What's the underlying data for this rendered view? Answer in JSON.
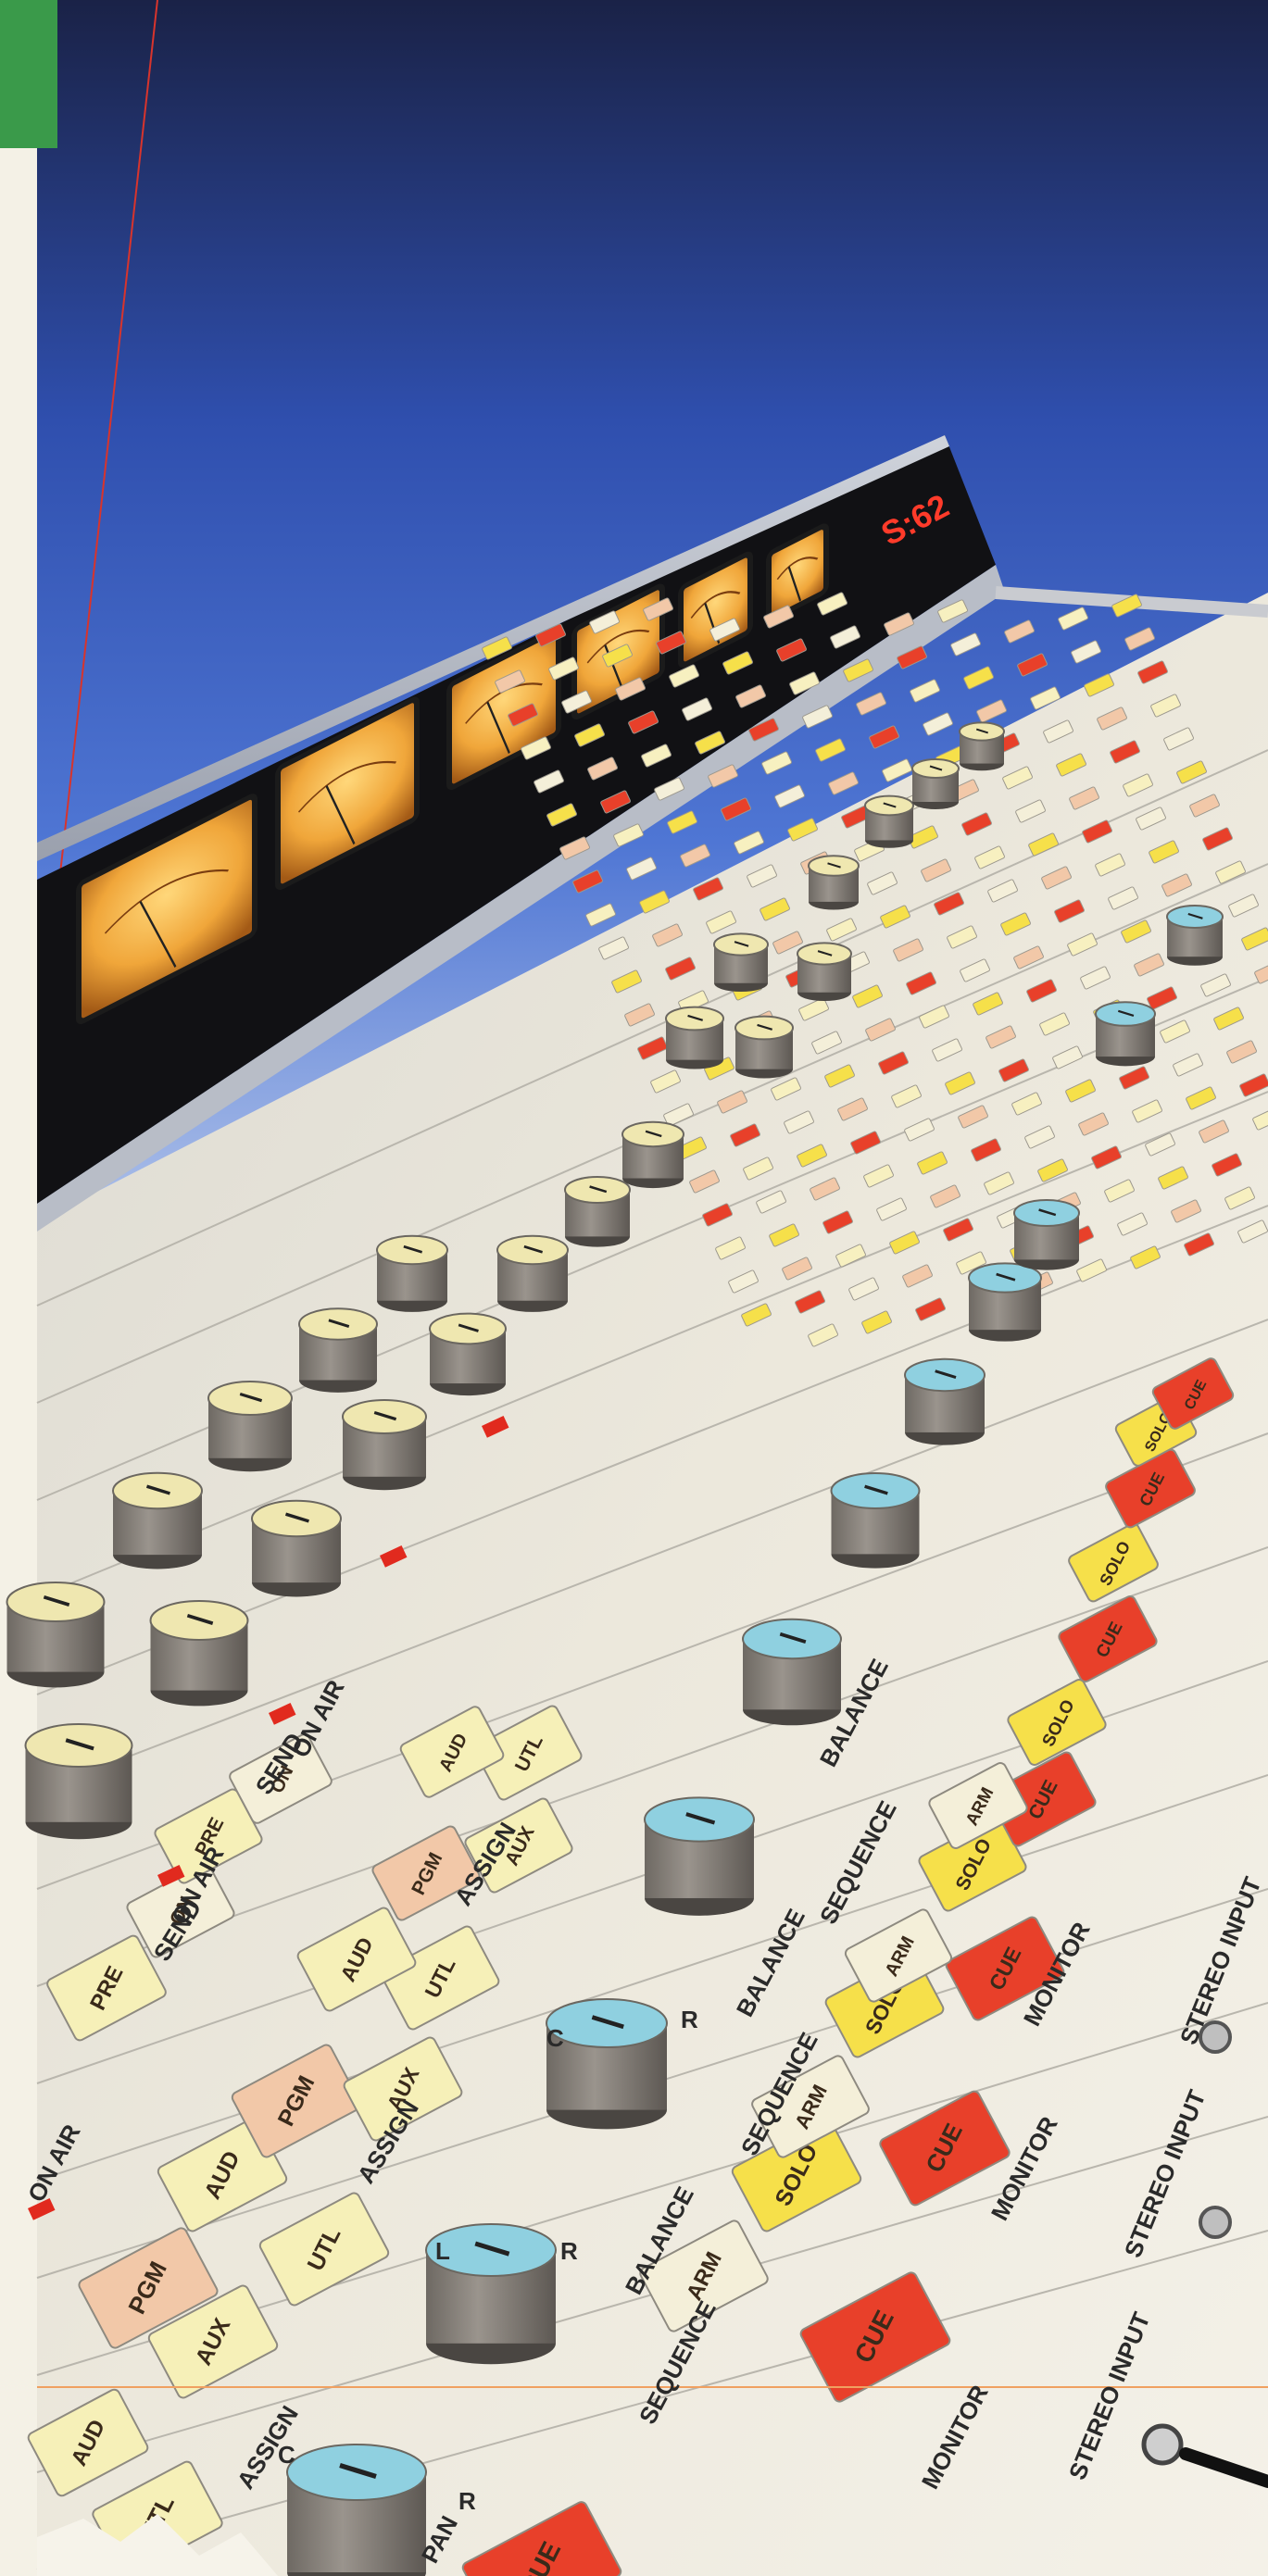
{
  "meters": {
    "display_readout": "S:62"
  },
  "strip_labels": {
    "on_air": "ON AIR",
    "pgm": "PGM",
    "aud": "AUD",
    "utl": "UTL",
    "aux": "AUX",
    "assign": "ASSIGN",
    "pre": "PRE",
    "on": "ON",
    "send": "SEND",
    "balance": "BALANCE",
    "sequence": "SEQUENCE",
    "arm": "ARM",
    "cue": "CUE",
    "solo": "SOLO",
    "monitor": "MONITOR",
    "stereo_input": "STEREO INPUT",
    "pan": "PAN",
    "l": "L",
    "r": "R",
    "c": "C"
  },
  "colors": {
    "sky_top": "#1f2a52",
    "sky_mid": "#3b62c9",
    "sky_bottom": "#9fb4e6",
    "panel": "#ece8dc",
    "meter_glow": "#f0a63a",
    "cue_red": "#e8402a",
    "solo_yellow": "#f6e04a",
    "knob_cap_blue": "#8fd0e0",
    "knob_cap_cream": "#efe7b0",
    "knob_body": "#8d8780",
    "accent_green": "#3a9a4a"
  }
}
